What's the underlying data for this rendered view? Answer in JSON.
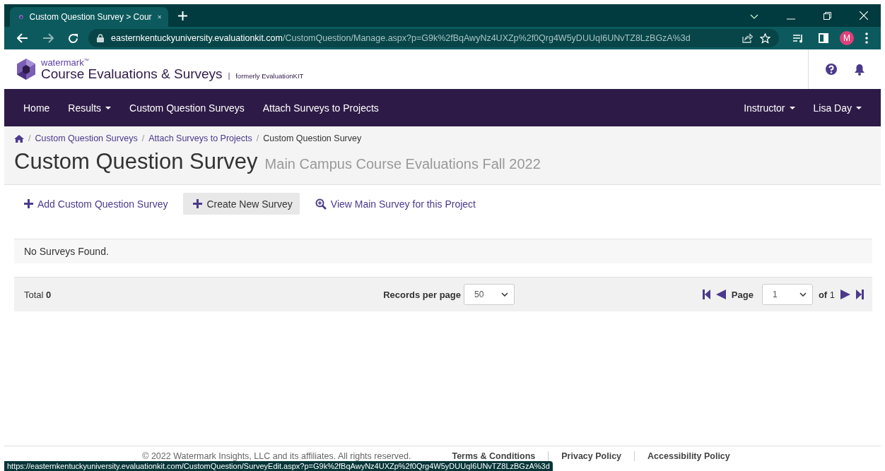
{
  "browser": {
    "tab_title": "Custom Question Survey > Cour",
    "url_host": "easternkentuckyuniversity.evaluationkit.com",
    "url_path": "/CustomQuestion/Manage.aspx?p=G9k%2fBqAwyNz4UXZp%2f0Qrg4W5yDUUqI6UNvTZ8LzBGzA%3d",
    "profile_initial": "M"
  },
  "header": {
    "brand_small": "watermark",
    "brand_tm": "™",
    "brand_title": "Course Evaluations & Surveys",
    "separator": "|",
    "brand_note": "formerly EvaluationKIT"
  },
  "nav": {
    "items": [
      {
        "label": "Home",
        "dropdown": false
      },
      {
        "label": "Results",
        "dropdown": true
      },
      {
        "label": "Custom Question Surveys",
        "dropdown": false
      },
      {
        "label": "Attach Surveys to Projects",
        "dropdown": false
      }
    ],
    "right_items": [
      {
        "label": "Instructor",
        "dropdown": true
      },
      {
        "label": "Lisa Day",
        "dropdown": true
      }
    ]
  },
  "breadcrumb_separator": "/",
  "breadcrumb": [
    {
      "label": "Custom Question Surveys",
      "current": false
    },
    {
      "label": "Attach Surveys to Projects",
      "current": false
    },
    {
      "label": "Custom Question Survey",
      "current": true
    }
  ],
  "page_title": "Custom Question Survey",
  "page_subtitle": "Main Campus Course Evaluations Fall 2022",
  "actions": [
    {
      "label": "Add Custom Question Survey",
      "kind": "plus",
      "selected": false
    },
    {
      "label": "Create New Survey",
      "kind": "plus",
      "selected": true
    },
    {
      "label": "View Main Survey for this Project",
      "kind": "zoom",
      "selected": false
    }
  ],
  "empty_message": "No Surveys Found.",
  "pager": {
    "total_label": "Total",
    "total": "0",
    "records_label": "Records per page",
    "records_value": "50",
    "page_label": "Page",
    "page_value": "1",
    "of_label": "of",
    "of_value": "1"
  },
  "footer": {
    "copyright": "© 2022 Watermark Insights, LLC and its affiliates. All rights reserved.",
    "links": [
      "Terms & Conditions",
      "Privacy Policy",
      "Accessibility Policy"
    ]
  },
  "status_url": "https://easternkentuckyuniversity.evaluationkit.com/CustomQuestion/SurveyEdit.aspx?p=G9k%2fBqAwyNz4UXZp%2f0Qrg4W5yDUUqI6UNvTZ8LzBGzA%3d"
}
